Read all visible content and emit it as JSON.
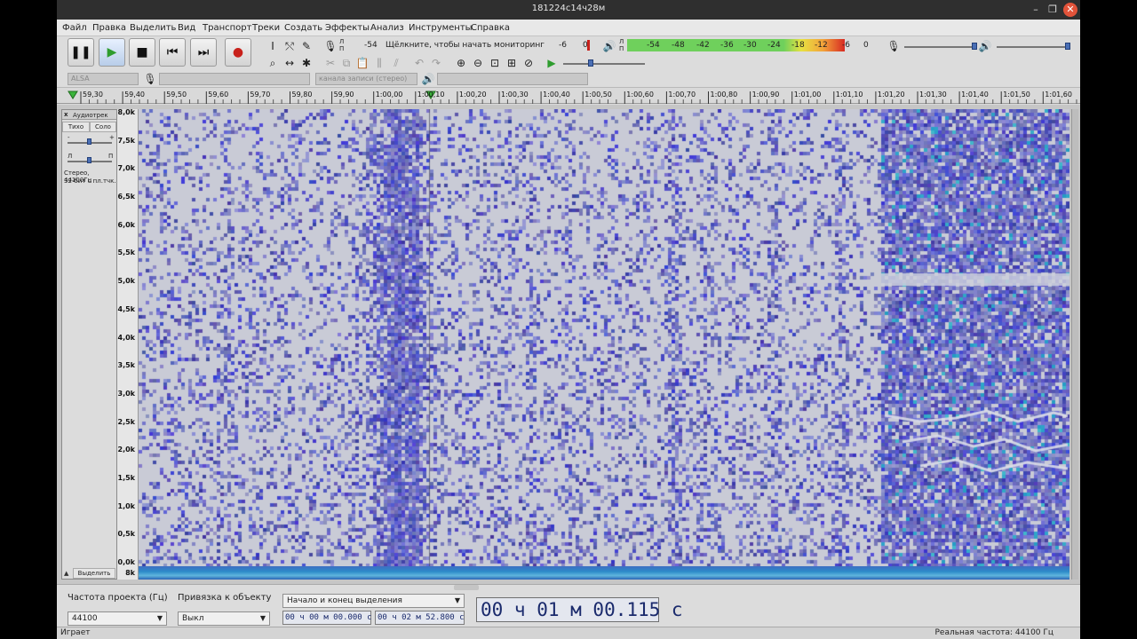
{
  "window": {
    "title": "181224с14ч28м"
  },
  "menu": [
    "Файл",
    "Правка",
    "Выделить",
    "Вид",
    "Транспорт",
    "Треки",
    "Создать",
    "Эффекты",
    "Анализ",
    "Инструменты",
    "Справка"
  ],
  "transport": {
    "pause": "❚❚",
    "play": "▶",
    "stop": "■",
    "skip_start": "⏮",
    "skip_end": "⏭",
    "record": "●"
  },
  "meters": {
    "rec_channels": "Л\nП",
    "rec_prompt": "Щёлкните, чтобы начать мониторинг",
    "rec_ticks": [
      "-54",
      "-6",
      "0"
    ],
    "play_channels": "Л\nП",
    "play_ticks": [
      "-54",
      "-48",
      "-42",
      "-36",
      "-30",
      "-24",
      "-18",
      "-12",
      "-6",
      "0"
    ]
  },
  "device": {
    "host": "ALSA",
    "rec_device": "",
    "channels": "канала записи (стерео)",
    "play_device": ""
  },
  "ruler": {
    "ticks": [
      "59,30",
      "59,40",
      "59,50",
      "59,60",
      "59,70",
      "59,80",
      "59,90",
      "1:00,00",
      "1:00,10",
      "1:00,20",
      "1:00,30",
      "1:00,40",
      "1:00,50",
      "1:00,60",
      "1:00,70",
      "1:00,80",
      "1:00,90",
      "1:01,00",
      "1:01,10",
      "1:01,20",
      "1:01,30",
      "1:01,40",
      "1:01,50",
      "1:01,60"
    ]
  },
  "track": {
    "name": "Аудиотрек",
    "mute": "Тихо",
    "solo": "Соло",
    "gain_minus": "-",
    "gain_plus": "+",
    "pan_left": "Л",
    "pan_right": "П",
    "info1": "Стерео, 44100Гц",
    "info2": "32-бит с пл.тчк.",
    "select": "Выделить",
    "close": "x",
    "collapse": "▲"
  },
  "freq_scale": [
    "8,0k",
    "7,5k",
    "7,0k",
    "6,5k",
    "6,0k",
    "5,5k",
    "5,0k",
    "4,5k",
    "4,0k",
    "3,5k",
    "3,0k",
    "2,5k",
    "2,0k",
    "1,5k",
    "1,0k",
    "0,5k",
    "0,0k"
  ],
  "freq_scale_bottom": "8k",
  "selection_toolbar": {
    "rate_label": "Частота проекта (Гц)",
    "rate_value": "44100",
    "snap_label": "Привязка к объекту",
    "snap_value": "Выкл",
    "mode_value": "Начало и конец выделения",
    "start_time": "00 ч 00 м 00.000 с",
    "end_time": "00 ч 02 м 52.800 с",
    "audio_position": "00 ч 01 м 00.115 с"
  },
  "status": {
    "left": "Играет",
    "right": "Реальная частота: 44100 Гц"
  },
  "colors": {
    "spectro_bg": "#c9cbd6",
    "spectro_blue": "#2d2fc8",
    "spectro_cyan": "#1fb2c8",
    "accent": "#4a6fb5"
  }
}
